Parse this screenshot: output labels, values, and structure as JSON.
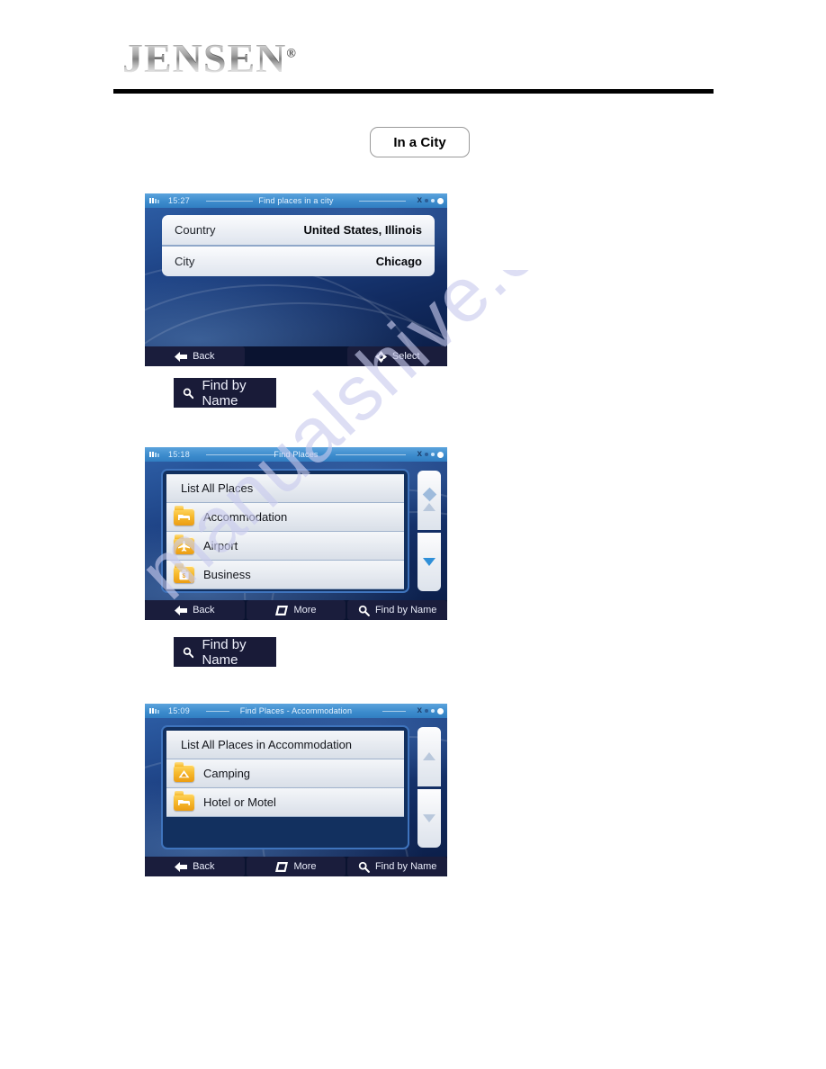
{
  "document": {
    "brand": "JENSEN",
    "brand_registered": "®",
    "watermark": "manualshive.com"
  },
  "caption_buttons": [
    {
      "id": "in-a-city",
      "label": "In a City"
    },
    {
      "id": "find-by-name-1",
      "label": "Find by Name",
      "icon": "search-icon"
    },
    {
      "id": "find-by-name-2",
      "label": "Find by Name",
      "icon": "search-icon"
    }
  ],
  "screens": [
    {
      "id": "find-places-in-a-city",
      "clock": "15:27",
      "title": "Find places in a city",
      "status_icons": [
        "satellite-icon",
        "signal-dot",
        "signal-dot",
        "battery-dot"
      ],
      "fields": [
        {
          "label": "Country",
          "value": "United States, Illinois"
        },
        {
          "label": "City",
          "value": "Chicago"
        }
      ],
      "bottom_buttons": [
        {
          "label": "Back",
          "icon": "arrow-left-icon"
        },
        {
          "label": "",
          "icon": ""
        },
        {
          "label": "Select",
          "icon": "crosshair-icon"
        }
      ]
    },
    {
      "id": "find-places",
      "clock": "15:18",
      "title": "Find Places",
      "status_icons": [
        "satellite-icon",
        "signal-dot",
        "signal-dot",
        "battery-dot"
      ],
      "list": [
        {
          "label": "List All Places",
          "icon": ""
        },
        {
          "label": "Accommodation",
          "icon": "bed-folder-icon"
        },
        {
          "label": "Airport",
          "icon": "airplane-folder-icon"
        },
        {
          "label": "Business",
          "icon": "briefcase-folder-icon"
        }
      ],
      "scroll": {
        "up": "diamond-up",
        "down": "chevron-down-active"
      },
      "bottom_buttons": [
        {
          "label": "Back",
          "icon": "arrow-left-icon"
        },
        {
          "label": "More",
          "icon": "more-icon"
        },
        {
          "label": "Find by Name",
          "icon": "search-icon"
        }
      ]
    },
    {
      "id": "find-places-accommodation",
      "clock": "15:09",
      "title": "Find Places - Accommodation",
      "status_icons": [
        "satellite-icon",
        "signal-dot",
        "signal-dot",
        "battery-dot"
      ],
      "list": [
        {
          "label": "List All Places in Accommodation",
          "icon": ""
        },
        {
          "label": "Camping",
          "icon": "tent-folder-icon"
        },
        {
          "label": "Hotel or Motel",
          "icon": "bed-folder-icon"
        }
      ],
      "scroll": {
        "up": "arrow-up-dim",
        "down": "arrow-down-dim"
      },
      "bottom_buttons": [
        {
          "label": "Back",
          "icon": "arrow-left-icon"
        },
        {
          "label": "More",
          "icon": "more-icon"
        },
        {
          "label": "Find by Name",
          "icon": "search-icon"
        }
      ]
    }
  ],
  "colors": {
    "rule": "#000000",
    "title_bar": "#3d8ccd",
    "screen_bg": "#12305f",
    "dark_button": "#191b38",
    "folder": "#f7bb2e",
    "accent_arrow": "#2f8fd8",
    "watermark": "#c9cbee"
  }
}
